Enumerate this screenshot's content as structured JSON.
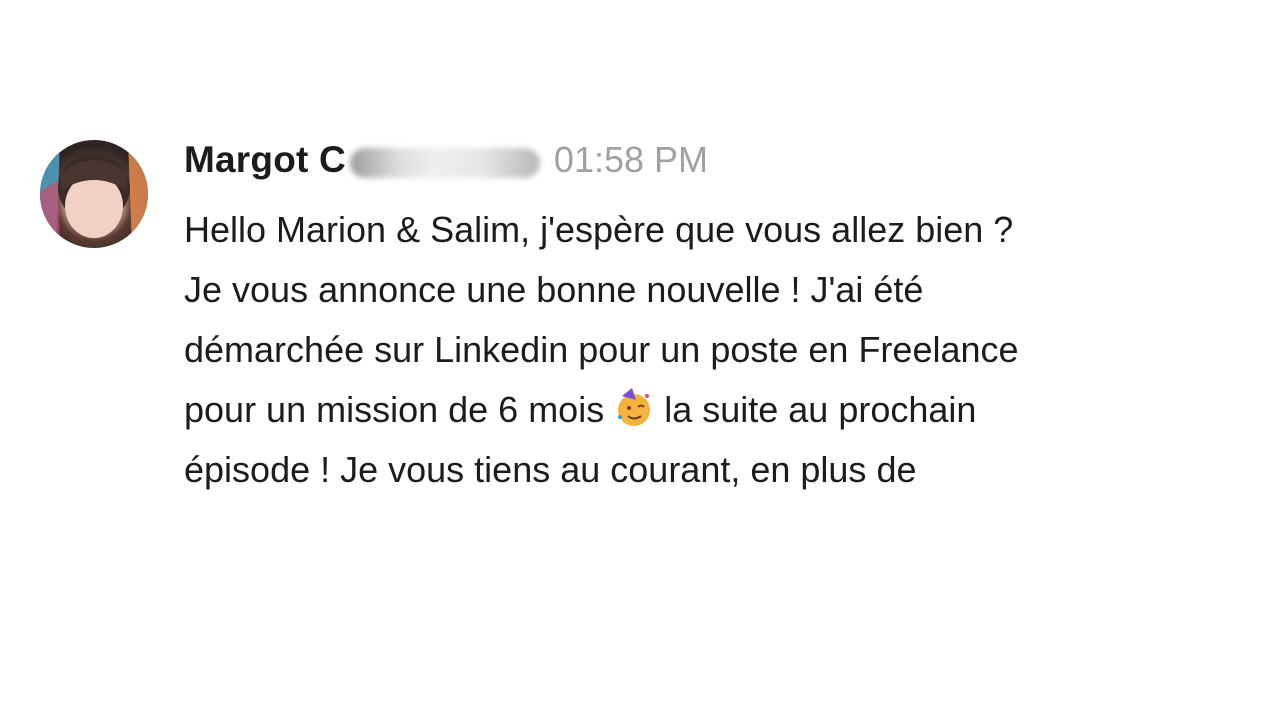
{
  "message": {
    "author": "Margot C",
    "timestamp": "01:58 PM",
    "emoji_icon": "partying-face-emoji-icon",
    "lines": [
      "Hello Marion & Salim, j'espère que vous allez bien ?",
      "Je vous annonce une bonne nouvelle ! J'ai été",
      "démarchée sur Linkedin pour un poste en Freelance",
      "pour un mission de 6 mois",
      "la suite au prochain",
      "épisode ! Je vous tiens au courant, en plus de"
    ]
  },
  "colors": {
    "author": "#1d1c1d",
    "timestamp": "#a1a1a4",
    "text": "#1d1c1d",
    "background": "#ffffff"
  }
}
